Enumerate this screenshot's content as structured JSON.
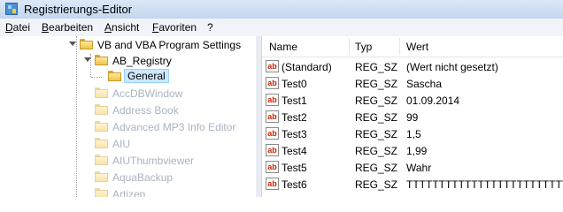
{
  "window": {
    "title": "Registrierungs-Editor"
  },
  "menu": [
    "Datei",
    "Bearbeiten",
    "Ansicht",
    "Favoriten",
    "?"
  ],
  "tree": {
    "items": [
      {
        "label": "VB and VBA Program Settings",
        "expanded": true
      },
      {
        "label": "AB_Registry",
        "expanded": true
      },
      {
        "label": "General",
        "selected": true
      },
      {
        "label": "AccDBWindow"
      },
      {
        "label": "Address Book"
      },
      {
        "label": "Advanced MP3 Info Editor"
      },
      {
        "label": "AIU"
      },
      {
        "label": "AIUThumbviewer"
      },
      {
        "label": "AquaBackup"
      },
      {
        "label": "Artizen"
      }
    ]
  },
  "list": {
    "columns": [
      "Name",
      "Typ",
      "Wert"
    ],
    "rows": [
      {
        "icon": "ab",
        "name": "(Standard)",
        "type": "REG_SZ",
        "value": "(Wert nicht gesetzt)"
      },
      {
        "icon": "ab",
        "name": "Test0",
        "type": "REG_SZ",
        "value": "Sascha"
      },
      {
        "icon": "ab",
        "name": "Test1",
        "type": "REG_SZ",
        "value": "01.09.2014"
      },
      {
        "icon": "ab",
        "name": "Test2",
        "type": "REG_SZ",
        "value": "99"
      },
      {
        "icon": "ab",
        "name": "Test3",
        "type": "REG_SZ",
        "value": "1,5"
      },
      {
        "icon": "ab",
        "name": "Test4",
        "type": "REG_SZ",
        "value": "1,99"
      },
      {
        "icon": "ab",
        "name": "Test5",
        "type": "REG_SZ",
        "value": "Wahr"
      },
      {
        "icon": "ab",
        "name": "Test6",
        "type": "REG_SZ",
        "value": "TTTTTTTTTTTTTTTTTTTTTTTTT"
      }
    ]
  },
  "colors": {
    "selection": "#cce8ff",
    "value_icon": "#cc2200",
    "faded_text": "#a9b3c2"
  }
}
